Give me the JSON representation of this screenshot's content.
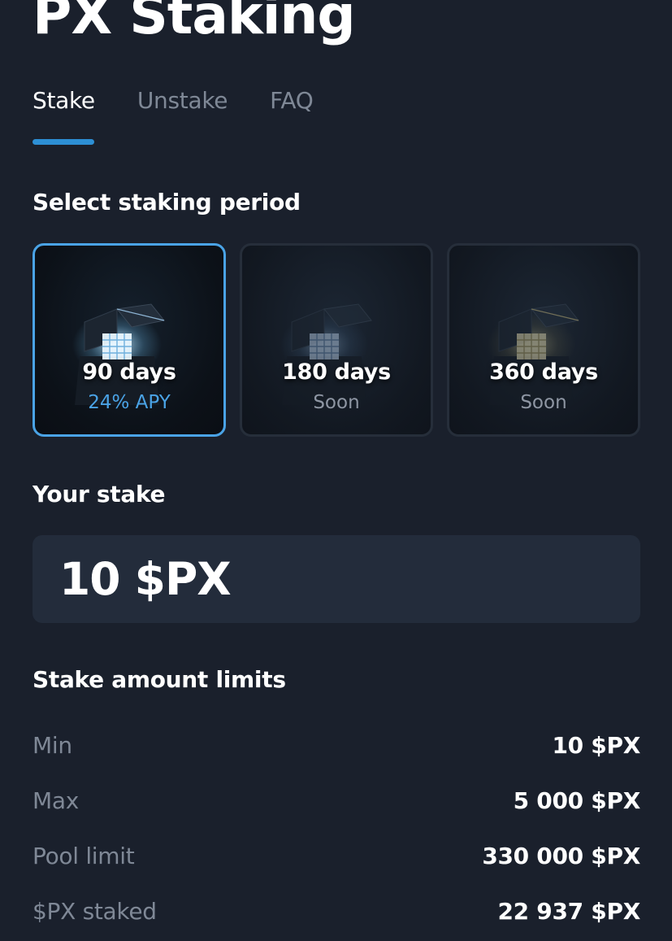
{
  "header": {
    "title": "PX Staking"
  },
  "tabs": [
    {
      "label": "Stake",
      "active": true
    },
    {
      "label": "Unstake",
      "active": false
    },
    {
      "label": "FAQ",
      "active": false
    }
  ],
  "period_section": {
    "heading": "Select staking period",
    "options": [
      {
        "days": "90 days",
        "sub": "24% APY",
        "selected": true,
        "icon": "treasure-box-icon",
        "glow": "#bfe6ff"
      },
      {
        "days": "180 days",
        "sub": "Soon",
        "selected": false,
        "icon": "treasure-box-icon",
        "glow": "#9fc4ea"
      },
      {
        "days": "360 days",
        "sub": "Soon",
        "selected": false,
        "icon": "treasure-box-icon",
        "glow": "#e6dca6"
      }
    ]
  },
  "stake_section": {
    "heading": "Your stake",
    "value": "10 $PX"
  },
  "limits_section": {
    "heading": "Stake amount limits",
    "rows": [
      {
        "label": "Min",
        "value": "10 $PX"
      },
      {
        "label": "Max",
        "value": "5 000 $PX"
      },
      {
        "label": "Pool limit",
        "value": "330 000 $PX"
      },
      {
        "label": "$PX staked",
        "value": "22 937 $PX"
      }
    ]
  },
  "colors": {
    "background": "#1a202c",
    "accent": "#2d8fd5",
    "selected_border": "#4aa3e6",
    "muted_text": "#7f8896",
    "input_background": "#232c3b"
  }
}
